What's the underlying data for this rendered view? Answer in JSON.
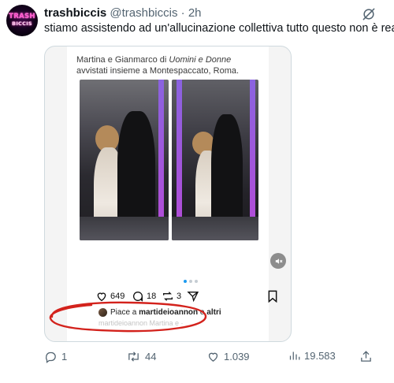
{
  "tweet": {
    "avatar_text_top": "TRASH",
    "avatar_text_bottom": "BICCIS",
    "display_name": "trashbiccis",
    "handle": "@trashbiccis",
    "separator": "·",
    "time": "2h",
    "text": "stiamo assistendo ad un'allucinazione collettiva tutto questo non è reale"
  },
  "embedded_post": {
    "caption_prefix": "Martina e Gianmarco di ",
    "caption_italic": "Uomini e Donne",
    "caption_suffix": "avvistati insieme a Montespaccato, Roma.",
    "likes_count": "649",
    "comments_count": "18",
    "reposts_count": "3",
    "liked_by_prefix": "Piace a ",
    "liked_by_user": "martideioannon",
    "liked_by_suffix": " e ",
    "liked_by_others": "altri",
    "faded_text": "martideioannon Martina e ·",
    "carousel_active_index": 0,
    "carousel_count": 3
  },
  "tweet_actions": {
    "replies": "1",
    "reposts": "44",
    "likes": "1.039",
    "views": "19.583"
  },
  "colors": {
    "accent": "#1d9bf0",
    "muted": "#536471",
    "annotation_red": "#d3221c"
  },
  "icons": [
    "grok-icon",
    "mute-icon",
    "heart-icon",
    "comment-icon",
    "repost-icon",
    "send-icon",
    "bookmark-icon",
    "views-icon",
    "share-icon"
  ]
}
